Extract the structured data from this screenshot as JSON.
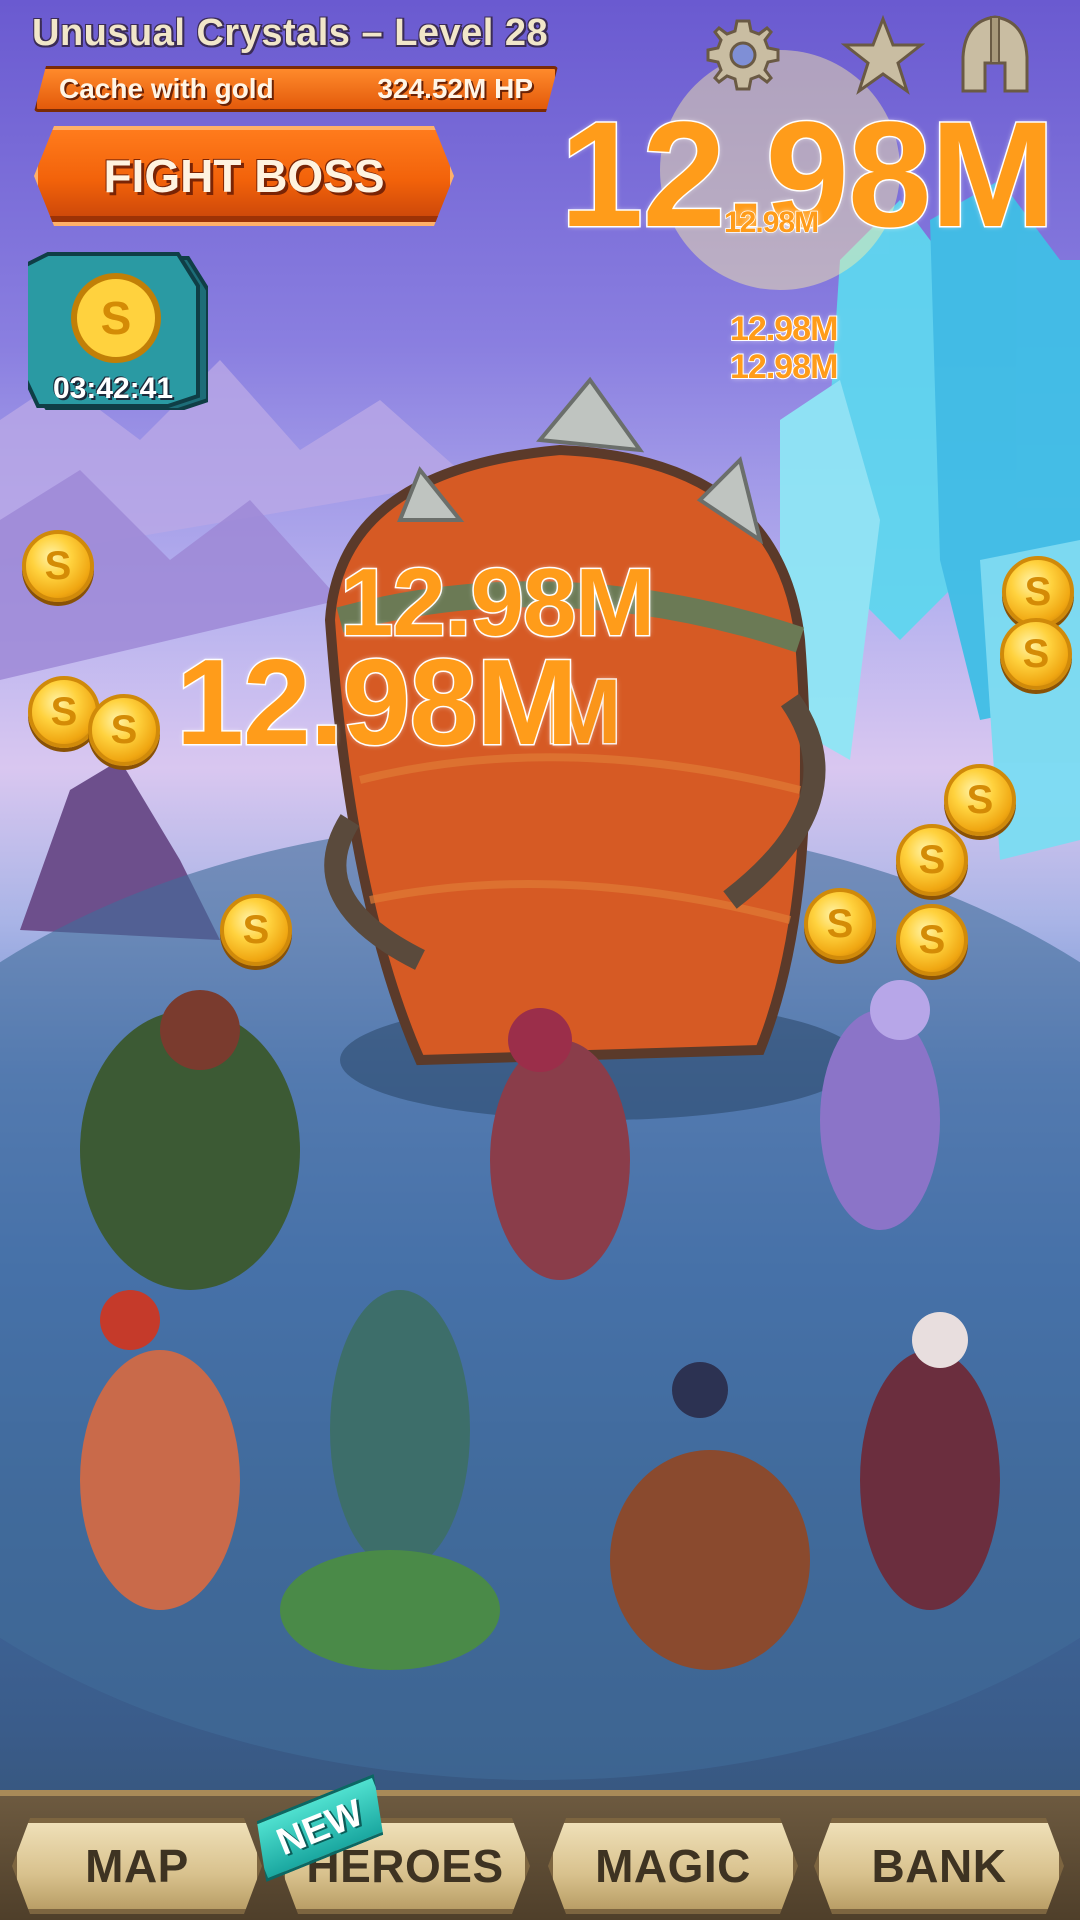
{
  "header": {
    "level_title": "Unusual Crystals – Level 28",
    "boss_name": "Cache with gold",
    "boss_hp": "324.52M HP",
    "fight_button": "FIGHT BOSS"
  },
  "top_icons": [
    "gear-icon",
    "star-icon",
    "helmet-icon"
  ],
  "chest": {
    "timer": "03:42:41"
  },
  "damage_numbers": {
    "big_top": "12.98M",
    "small_top": "12.98M",
    "float_a": "12.98M",
    "float_b": "12.98M",
    "mid_a": "12.98M",
    "mid_b": "12.98M",
    "mid_ghost": "M"
  },
  "coin_symbol": "S",
  "nav": {
    "map": "MAP",
    "heroes": "HEROES",
    "magic": "MAGIC",
    "bank": "BANK",
    "new_badge": "NEW"
  },
  "colors": {
    "accent_orange": "#f2620a",
    "damage_orange": "#ff9c1a",
    "coin_gold": "#ffd23e",
    "nav_button": "#d8c18d",
    "new_badge_teal": "#1aa7a0"
  }
}
